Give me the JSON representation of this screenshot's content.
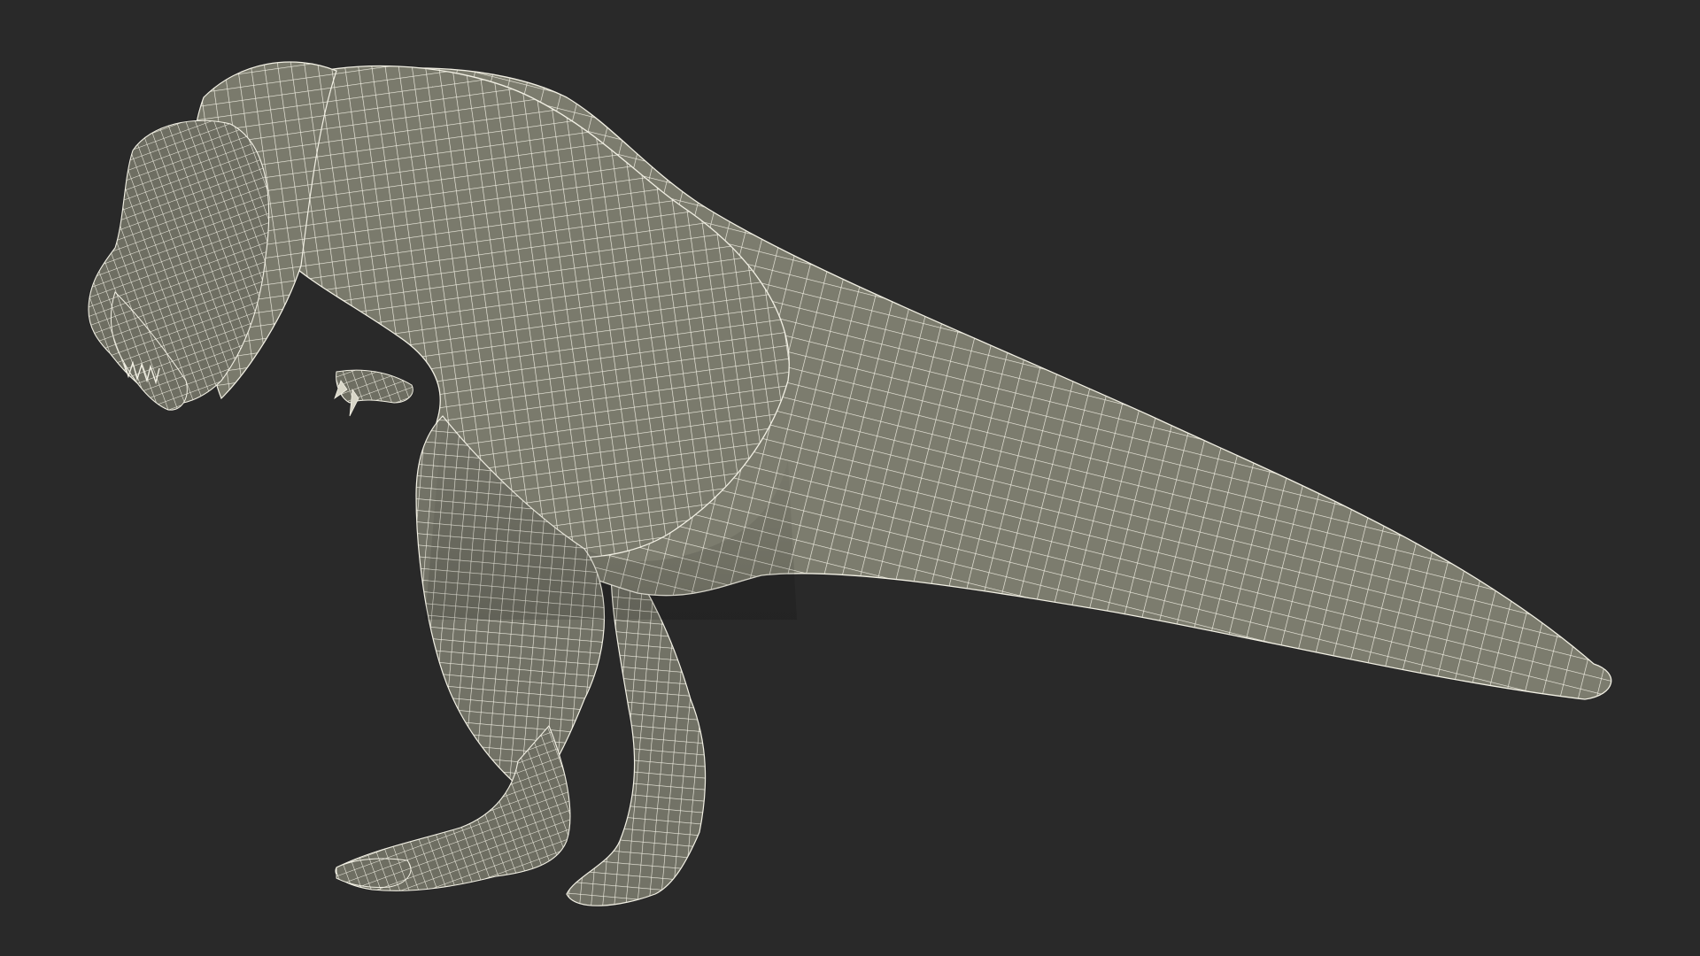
{
  "scene": {
    "subject_icon": "tyrannosaurus-wireframe",
    "background_color": "#292929",
    "mesh_fill_color": "#7a7a6c",
    "mesh_shade_color": "#5f5f54",
    "wire_color": "#f2f0e4"
  }
}
